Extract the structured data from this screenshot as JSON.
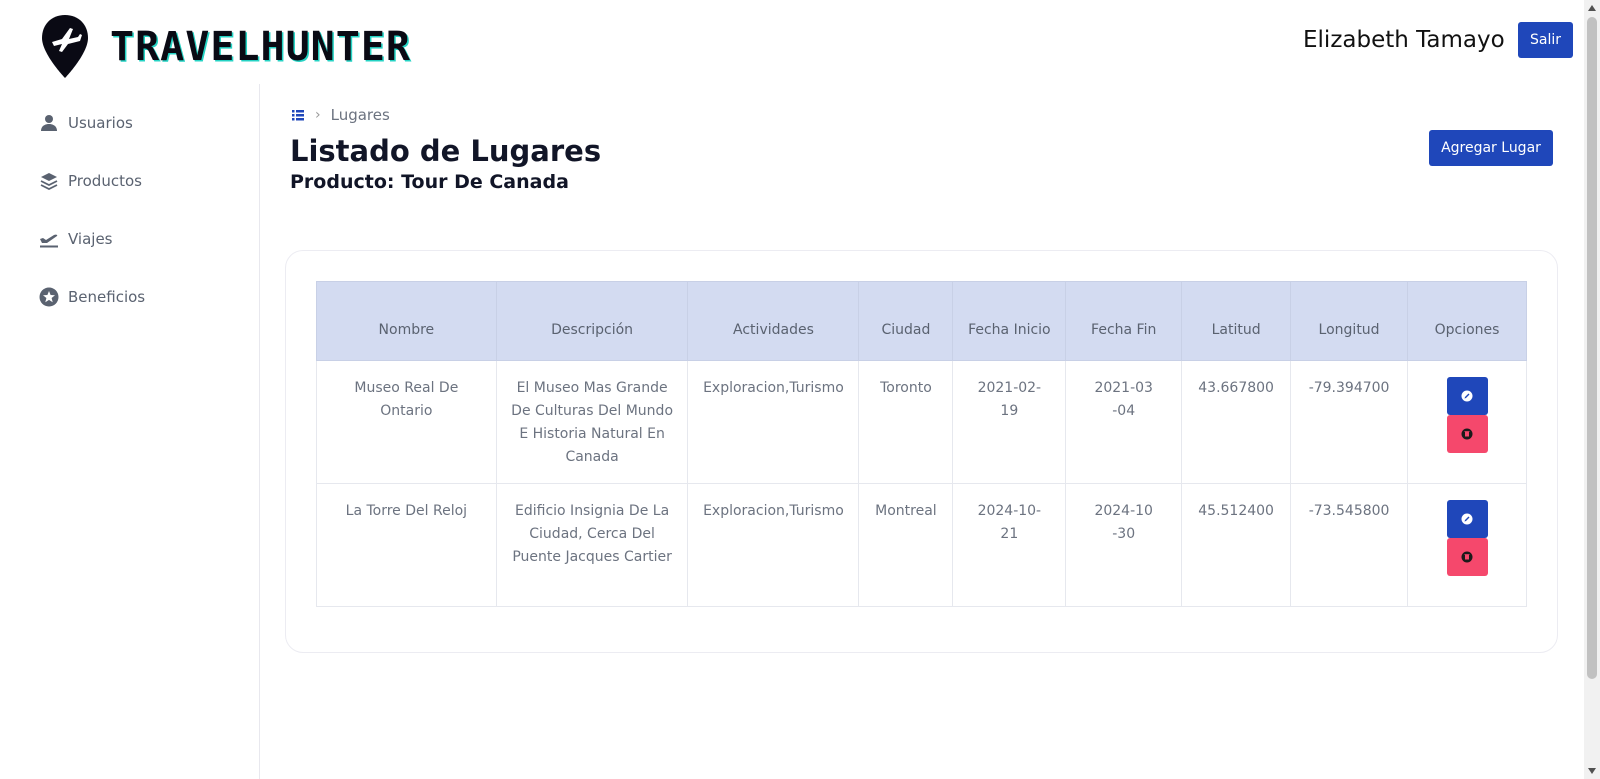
{
  "header": {
    "brand": "TRAVELHUNTER",
    "user_name": "Elizabeth Tamayo",
    "logout_label": "Salir"
  },
  "sidebar": {
    "items": [
      {
        "label": "Usuarios",
        "icon": "user-icon"
      },
      {
        "label": "Productos",
        "icon": "layers-icon"
      },
      {
        "label": "Viajes",
        "icon": "plane-departure-icon"
      },
      {
        "label": "Beneficios",
        "icon": "star-circle-icon"
      }
    ]
  },
  "breadcrumb": {
    "current": "Lugares"
  },
  "main": {
    "title": "Listado de Lugares",
    "subtitle": "Producto: Tour De Canada",
    "add_label": "Agregar Lugar"
  },
  "table": {
    "headers": [
      "Nombre",
      "Descripción",
      "Actividades",
      "Ciudad",
      "Fecha Inicio",
      "Fecha Fin",
      "Latitud",
      "Longitud",
      "Opciones"
    ],
    "rows": [
      {
        "nombre": "Museo Real De Ontario",
        "descripcion": "El Museo Mas Grande De Culturas Del Mundo E Historia Natural En Canada",
        "actividades": "Exploracion,Turismo",
        "ciudad": "Toronto",
        "fecha_inicio": "2021-02-19",
        "fecha_fin": "2021-03-04",
        "latitud": "43.667800",
        "longitud": "-79.394700"
      },
      {
        "nombre": "La Torre Del Reloj",
        "descripcion": "Edificio Insignia De La Ciudad, Cerca Del Puente Jacques Cartier",
        "actividades": "Exploracion,Turismo",
        "ciudad": "Montreal",
        "fecha_inicio": "2024-10-21",
        "fecha_fin": "2024-10-30",
        "latitud": "45.512400",
        "longitud": "-73.545800"
      }
    ]
  },
  "colors": {
    "primary": "#1f47ba",
    "danger": "#f5486c",
    "table_header_bg": "#d3dbf1",
    "brand_accent": "#25d3c4"
  }
}
